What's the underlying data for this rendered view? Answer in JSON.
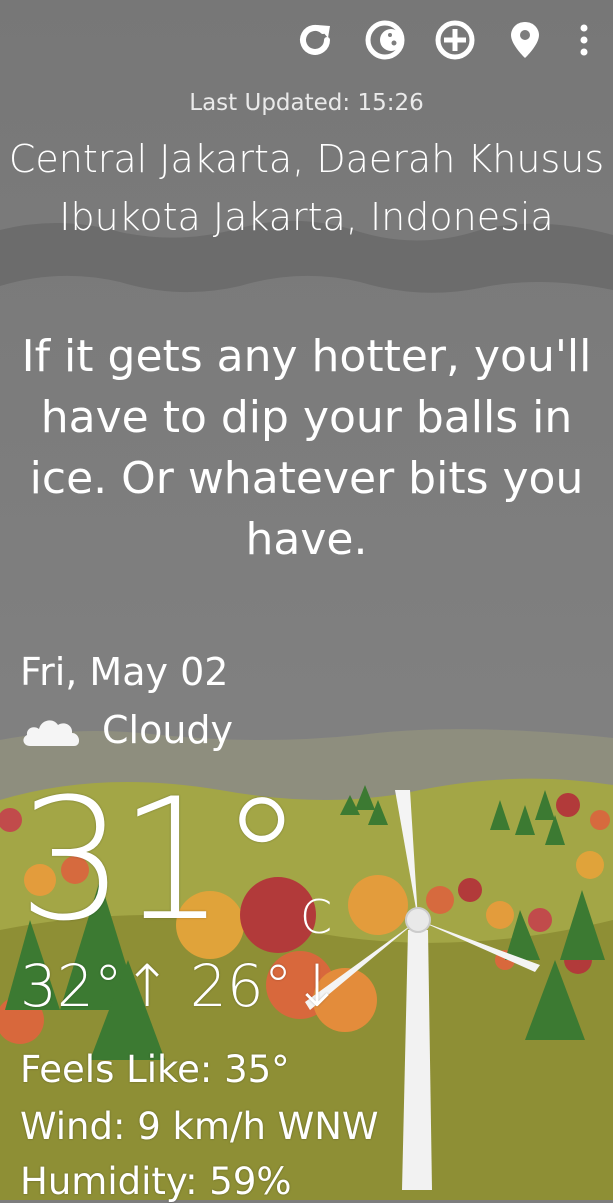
{
  "toolbar": {
    "refresh_icon": "refresh-icon",
    "theme_icon": "moon-icon",
    "add_icon": "add-circle-icon",
    "location_icon": "location-pin-icon",
    "menu_icon": "more-vert-icon"
  },
  "last_updated": "Last Updated: 15:26",
  "location": {
    "line1": "Central Jakarta, Daerah Khusus",
    "line2": "Ibukota Jakarta, Indonesia"
  },
  "quote": {
    "line1": "If it gets any hotter, you'll",
    "line2": "have to dip your balls in",
    "line3": "ice. Or whatever bits you",
    "line4": "have."
  },
  "date": "Fri, May 02",
  "condition": {
    "icon": "cloud-icon",
    "label": "Cloudy"
  },
  "temperature": {
    "current": "31°",
    "unit": "C",
    "high_low": "32°↑ 26°↓"
  },
  "details": {
    "feels_like": "Feels Like:  35°",
    "wind": "Wind:  9 km/h WNW",
    "humidity": "Humidity:  59%"
  },
  "colors": {
    "sky": "#7d7d7d",
    "hills": "#a3a646",
    "grass": "#8e8f35",
    "tree_dark": "#3c7a32"
  }
}
